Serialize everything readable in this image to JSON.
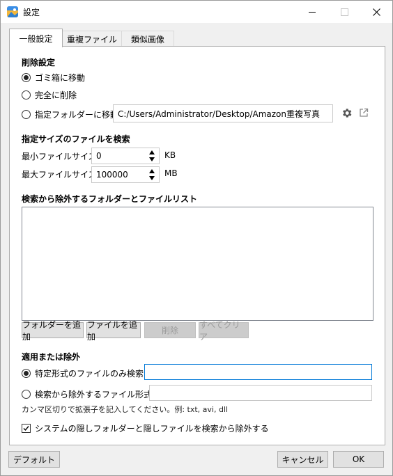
{
  "window": {
    "title": "設定"
  },
  "tabs": [
    {
      "label": "一般設定"
    },
    {
      "label": "重複ファイル"
    },
    {
      "label": "類似画像"
    }
  ],
  "delete_settings": {
    "heading": "削除設定",
    "options": [
      {
        "label": "ゴミ箱に移動",
        "selected": true
      },
      {
        "label": "完全に削除",
        "selected": false
      },
      {
        "label": "指定フォルダーに移動",
        "selected": false
      }
    ],
    "folder_path": "C:/Users/Administrator/Desktop/Amazon重複写真"
  },
  "size_filter": {
    "heading": "指定サイズのファイルを検索",
    "min_label": "最小ファイルサイズ",
    "min_value": "0",
    "min_unit": "KB",
    "max_label": "最大ファイルサイズ",
    "max_value": "100000",
    "max_unit": "MB"
  },
  "exclude_list": {
    "heading": "検索から除外するフォルダーとファイルリスト",
    "buttons": {
      "add_folder": "フォルダーを追加",
      "add_file": "ファイルを追加",
      "delete": "削除",
      "clear_all": "すべてクリア"
    }
  },
  "apply_or_exclude": {
    "heading": "適用または除外",
    "include_label": "特定形式のファイルのみ検索:",
    "include_value": "",
    "exclude_label": "検索から除外するファイル形式:",
    "exclude_value": "",
    "note": "カンマ区切りで拡張子を記入してください。例:  txt, avi, dll",
    "hidden_checkbox_label": "システムの隠しフォルダーと隠しファイルを検索から除外する",
    "hidden_checked": true
  },
  "footer": {
    "default_button": "デフォルト",
    "cancel_button": "キャンセル",
    "ok_button": "OK"
  },
  "colors": {
    "accent": "#0078d7",
    "window_bg": "#f0f0f0"
  }
}
